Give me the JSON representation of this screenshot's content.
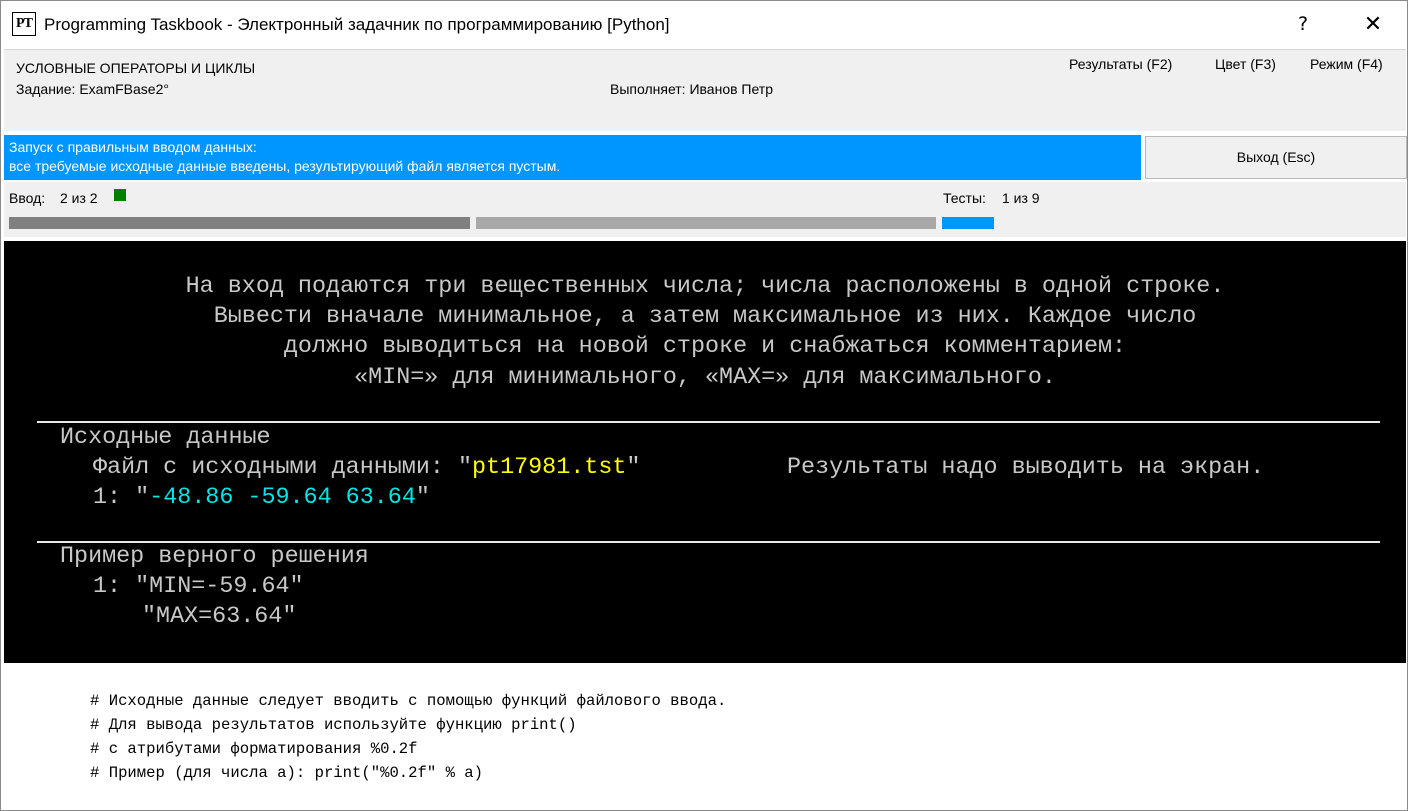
{
  "window": {
    "icon_text": "PT",
    "title": "Programming Taskbook - Электронный задачник по программированию [Python]",
    "help_glyph": "?",
    "close_glyph": "✕"
  },
  "header": {
    "section_title": "УСЛОВНЫЕ ОПЕРАТОРЫ И ЦИКЛЫ",
    "task_label": "Задание: ExamFBase2°",
    "student_label": "Выполняет: Иванов Петр",
    "menu": {
      "results": "Результаты (F2)",
      "color": "Цвет (F3)",
      "mode": "Режим (F4)"
    }
  },
  "status": {
    "line1": "Запуск с правильным вводом данных:",
    "line2": " все требуемые исходные данные введены, результирующий файл является пустым.",
    "exit_button": "Выход (Esc)",
    "color": "#0096ff"
  },
  "progress": {
    "input_label": "Ввод:",
    "input_count": "2 из 2",
    "tests_label": "Тесты:",
    "tests_count": "1 из 9",
    "indicator_color": "#008000"
  },
  "task": {
    "lines": [
      "На вход подаются три вещественных числа; числа расположены в одной строке.",
      "Вывести вначале минимальное, а затем максимальное из них. Каждое число",
      "должно выводиться на новой строке и снабжаться комментарием:",
      "«MIN=» для минимального, «MAX=» для максимального."
    ],
    "input_section": {
      "title": "Исходные данные",
      "file_prefix": "Файл с исходными данными: \"",
      "file_name": "pt17981.tst",
      "file_suffix": "\"",
      "output_note": "Результаты надо выводить на экран.",
      "line_prefix": "1: \"",
      "line_value": "-48.86 -59.64 63.64",
      "line_suffix": "\""
    },
    "example_section": {
      "title": "Пример верного решения",
      "line1": "1: \"MIN=-59.64\"",
      "line2": "\"MAX=63.64\""
    }
  },
  "code": {
    "lines": [
      "# Исходные данные следует вводить с помощью функций файлового ввода.",
      "# Для вывода результатов используйте функцию print()",
      "# с атрибутами форматирования %0.2f",
      "# Пример (для числа a): print(\"%0.2f\" % a)"
    ]
  }
}
